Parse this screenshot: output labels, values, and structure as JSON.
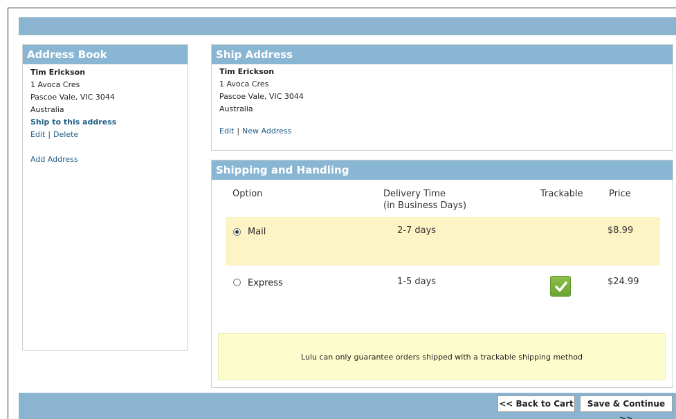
{
  "address_book": {
    "title": "Address Book",
    "name": "Tim Erickson",
    "line1": "1 Avoca Cres",
    "line2": "Pascoe Vale, VIC 3044",
    "country": "Australia",
    "ship_link": "Ship to this address",
    "edit_link": "Edit",
    "separator": "|",
    "delete_link": "Delete",
    "add_link": "Add Address"
  },
  "ship_address": {
    "title": "Ship Address",
    "name": "Tim Erickson",
    "line1": "1 Avoca Cres",
    "line2": "Pascoe Vale, VIC 3044",
    "country": "Australia",
    "edit_link": "Edit",
    "separator": "|",
    "new_link": "New Address"
  },
  "shipping": {
    "title": "Shipping and Handling",
    "headers": {
      "option": "Option",
      "delivery_line1": "Delivery Time",
      "delivery_line2": "(in Business Days)",
      "trackable": "Trackable",
      "price": "Price"
    },
    "options": [
      {
        "label": "Mail",
        "delivery": "2-7 days",
        "trackable": false,
        "price": "$8.99",
        "selected": true
      },
      {
        "label": "Express",
        "delivery": "1-5 days",
        "trackable": true,
        "price": "$24.99",
        "selected": false
      }
    ],
    "notice": "Lulu can only guarantee orders shipped with a trackable shipping method"
  },
  "buttons": {
    "back": "<< Back to Cart",
    "save": "Save & Continue >>"
  },
  "colors": {
    "header_bar": "#89b6d3",
    "selected_row": "#fdf4c6",
    "notice_bg": "#fdfccc",
    "link": "#1f5d86",
    "check_green": "#7ab33d"
  },
  "icons": {
    "trackable": "checkmark-icon",
    "radio": "radio-button"
  }
}
